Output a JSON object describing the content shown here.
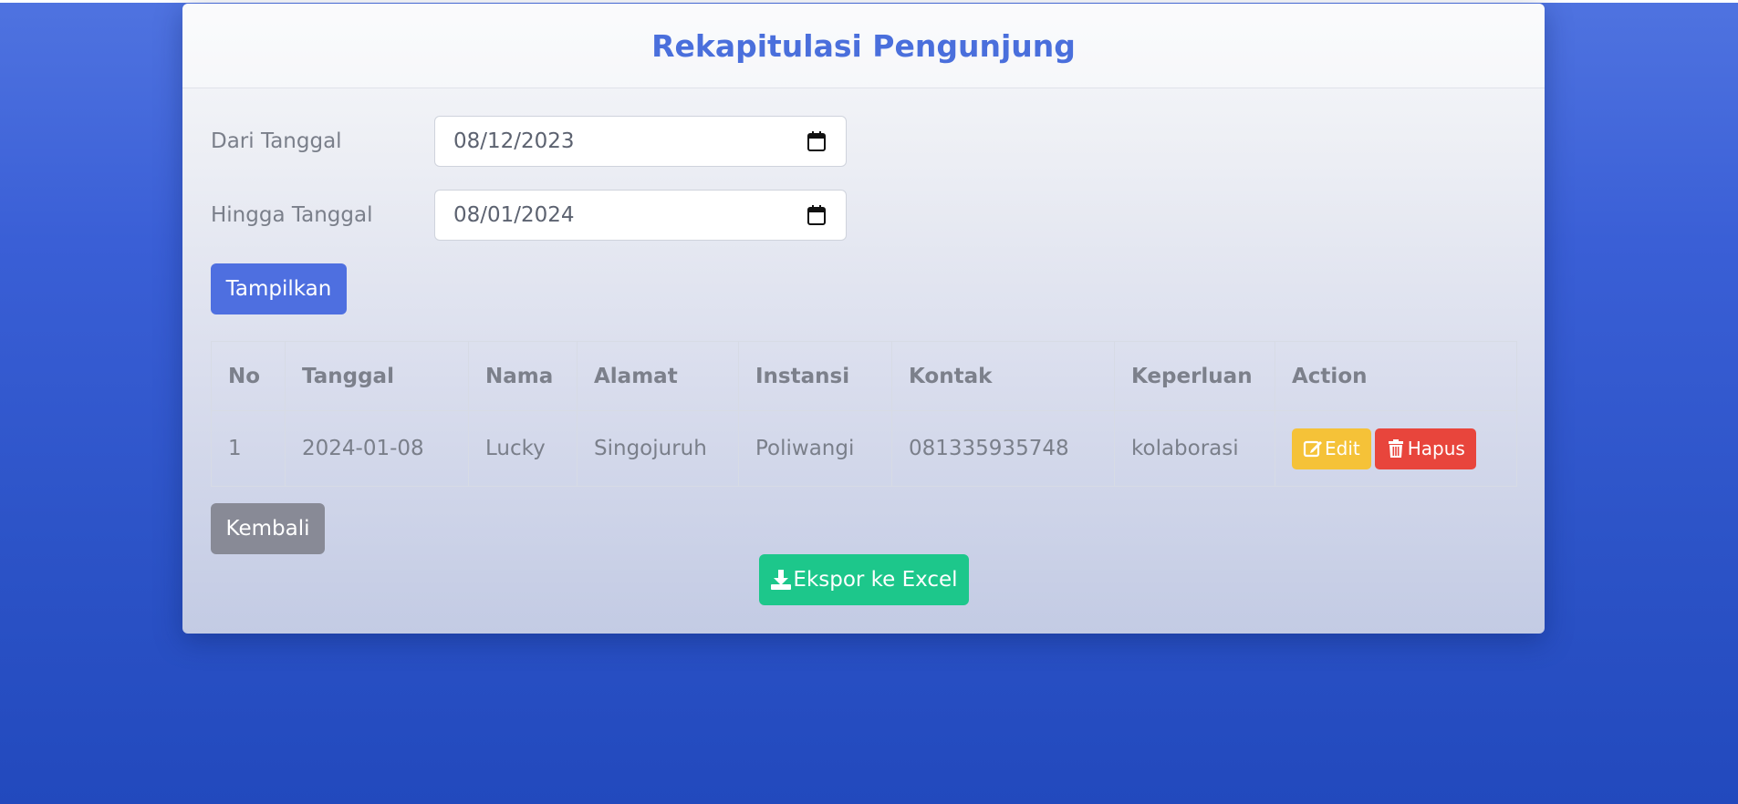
{
  "page": {
    "title": "Rekapitulasi Pengunjung"
  },
  "filter": {
    "from_label": "Dari Tanggal",
    "from_value": "08/12/2023",
    "to_label": "Hingga Tanggal",
    "to_value": "08/01/2024",
    "submit_label": "Tampilkan"
  },
  "table": {
    "columns": [
      "No",
      "Tanggal",
      "Nama",
      "Alamat",
      "Instansi",
      "Kontak",
      "Keperluan",
      "Action"
    ],
    "rows": [
      {
        "no": "1",
        "tanggal": "2024-01-08",
        "nama": "Lucky",
        "alamat": "Singojuruh",
        "instansi": "Poliwangi",
        "kontak": "081335935748",
        "keperluan": "kolaborasi",
        "edit_label": "Edit",
        "delete_label": "Hapus"
      }
    ]
  },
  "actions": {
    "back_label": "Kembali",
    "export_label": "Ekspor ke Excel"
  },
  "icons": {
    "calendar": "calendar-icon",
    "edit": "edit-icon",
    "delete": "trash-icon",
    "export": "download-icon"
  },
  "colors": {
    "title": "#4a6fdc",
    "primary": "#4e6fe0",
    "secondary": "#888a96",
    "success": "#1dc78b",
    "warning": "#f5c238",
    "danger": "#e8453c"
  }
}
